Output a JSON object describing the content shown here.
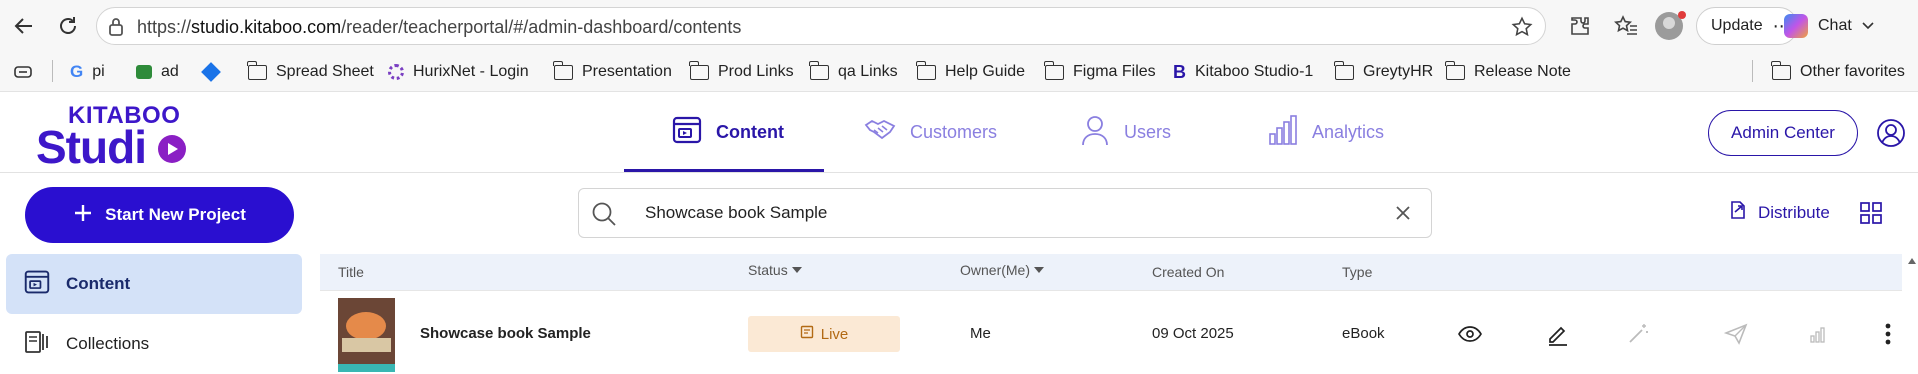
{
  "browser": {
    "url_prefix": "https://",
    "url_host": "studio.kitaboo.com",
    "url_path": "/reader/teacherportal/#/admin-dashboard/contents",
    "update_label": "Update",
    "chat_label": "Chat",
    "bookmarks": [
      {
        "label": "pi",
        "icon": "google-icon"
      },
      {
        "label": "ad",
        "icon": "chat-app-icon"
      },
      {
        "label": "Spread Sheet",
        "icon": "folder-icon"
      },
      {
        "label": "HurixNet - Login",
        "icon": "spinner-logo-icon"
      },
      {
        "label": "Presentation",
        "icon": "folder-icon"
      },
      {
        "label": "Prod Links",
        "icon": "folder-icon"
      },
      {
        "label": "qa Links",
        "icon": "folder-icon"
      },
      {
        "label": "Help Guide",
        "icon": "folder-icon"
      },
      {
        "label": "Figma Files",
        "icon": "folder-icon"
      },
      {
        "label": "Kitaboo Studio-1",
        "icon": "kitaboo-b-icon"
      },
      {
        "label": "GreytyHR",
        "icon": "folder-icon"
      },
      {
        "label": "Release Note",
        "icon": "folder-icon"
      }
    ],
    "other_favorites": "Other favorites"
  },
  "app": {
    "logo_top": "KITABOO",
    "logo_bottom": "Studi",
    "nav_tabs": [
      {
        "label": "Content",
        "icon": "content-icon",
        "active": true
      },
      {
        "label": "Customers",
        "icon": "handshake-icon",
        "active": false
      },
      {
        "label": "Users",
        "icon": "user-icon",
        "active": false
      },
      {
        "label": "Analytics",
        "icon": "bar-chart-icon",
        "active": false
      }
    ],
    "admin_center": "Admin Center",
    "start_new_project": "Start New Project",
    "search_value": "Showcase book Sample",
    "distribute": "Distribute",
    "sidebar": [
      {
        "label": "Content",
        "icon": "content-icon",
        "active": true
      },
      {
        "label": "Collections",
        "icon": "collections-icon",
        "active": false
      }
    ],
    "table": {
      "headers": {
        "title": "Title",
        "status": "Status",
        "owner": "Owner(Me)",
        "created_on": "Created On",
        "type": "Type"
      },
      "rows": [
        {
          "title": "Showcase book Sample",
          "status": "Live",
          "owner": "Me",
          "created_on": "09 Oct 2025",
          "type": "eBook",
          "actions": [
            "eye-icon",
            "edit-pencil-icon",
            "magic-wand-icon",
            "send-icon",
            "analytics-icon",
            "more-vertical-icon"
          ]
        }
      ]
    }
  },
  "colors": {
    "brand": "#2a16a8",
    "primary_button": "#2a0fd0",
    "live_badge_bg": "#fbe9d5",
    "live_badge_text": "#b26a14",
    "sidebar_active": "#d4e2f8"
  }
}
